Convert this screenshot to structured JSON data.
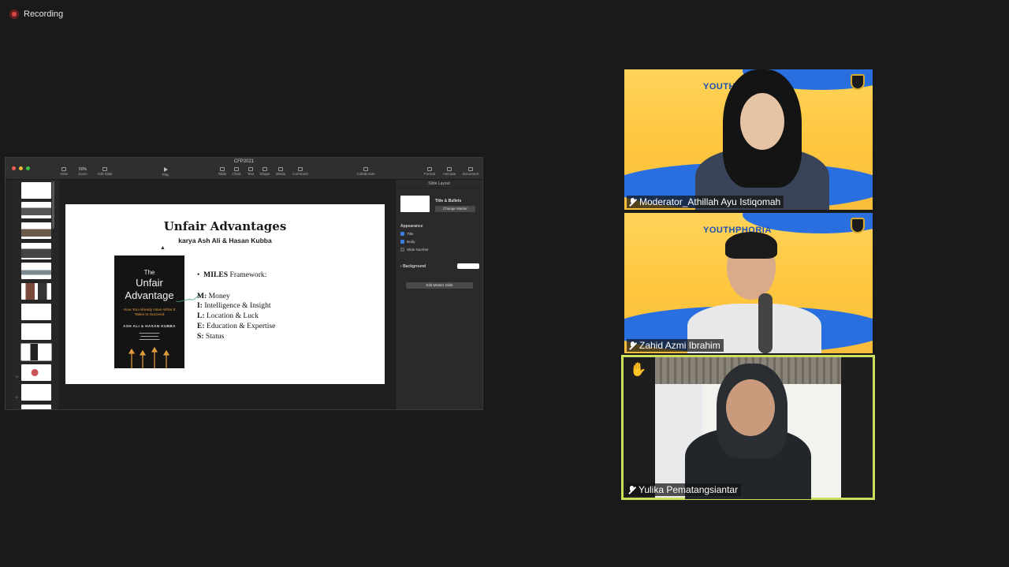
{
  "recording": {
    "label": "Recording"
  },
  "keynote": {
    "window_title": "CFP2021",
    "toolbar": {
      "view": "View",
      "zoom_value": "50%",
      "zoom": "Zoom",
      "add_slide": "Add Slide",
      "play": "Play",
      "table": "Table",
      "chart": "Chart",
      "text": "Text",
      "shape": "Shape",
      "media": "Media",
      "comment": "Comment",
      "collaborate": "Collaborate",
      "format": "Format",
      "animate": "Animate",
      "document": "Document"
    },
    "thumbnail_numbers": [
      "1",
      "2",
      "3",
      "4",
      "5",
      "6",
      "7",
      "8",
      "9",
      "10",
      "11"
    ],
    "slide": {
      "title": "Unfair Advantages",
      "subtitle": "karya Ash Ali & Hasan Kubba",
      "book": {
        "the": "The",
        "title_line1": "Unfair",
        "title_line2": "Advantage",
        "tagline": "How You Already Have What It Takes to Succeed",
        "authors": "ASH ALI & HASAN KUBBA"
      },
      "framework_bold": "MILES",
      "framework_rest": " Framework:",
      "items": [
        {
          "key": "M:",
          "text": " Money"
        },
        {
          "key": "I:",
          "text": " Intelligence & Insight"
        },
        {
          "key": "L:",
          "text": " Location & Luck"
        },
        {
          "key": "E:",
          "text": " Education & Expertise"
        },
        {
          "key": "S:",
          "text": " Status"
        }
      ]
    },
    "inspector": {
      "header": "Slide Layout",
      "layout_name": "Title & Bullets",
      "change_master": "Change Master",
      "appearance": "Appearance",
      "title_check": "Title",
      "body_check": "Body",
      "slide_number_check": "Slide Number",
      "background": "Background",
      "edit_master": "Edit Master Slide"
    }
  },
  "participants": [
    {
      "name": "Moderator_Athillah Ayu Istiqomah",
      "banner_text": "YOUTHPHORIA"
    },
    {
      "name": "Zahid Azmi Ibrahim",
      "banner_text": "YOUTHPHORIA"
    },
    {
      "name": "Yulika Pematangsiantar"
    }
  ],
  "colors": {
    "active_speaker_border": "#cde05a",
    "recording_dot": "#e04848",
    "banner_blue": "#2a6fe0",
    "banner_yellow": "#ffc63e"
  }
}
